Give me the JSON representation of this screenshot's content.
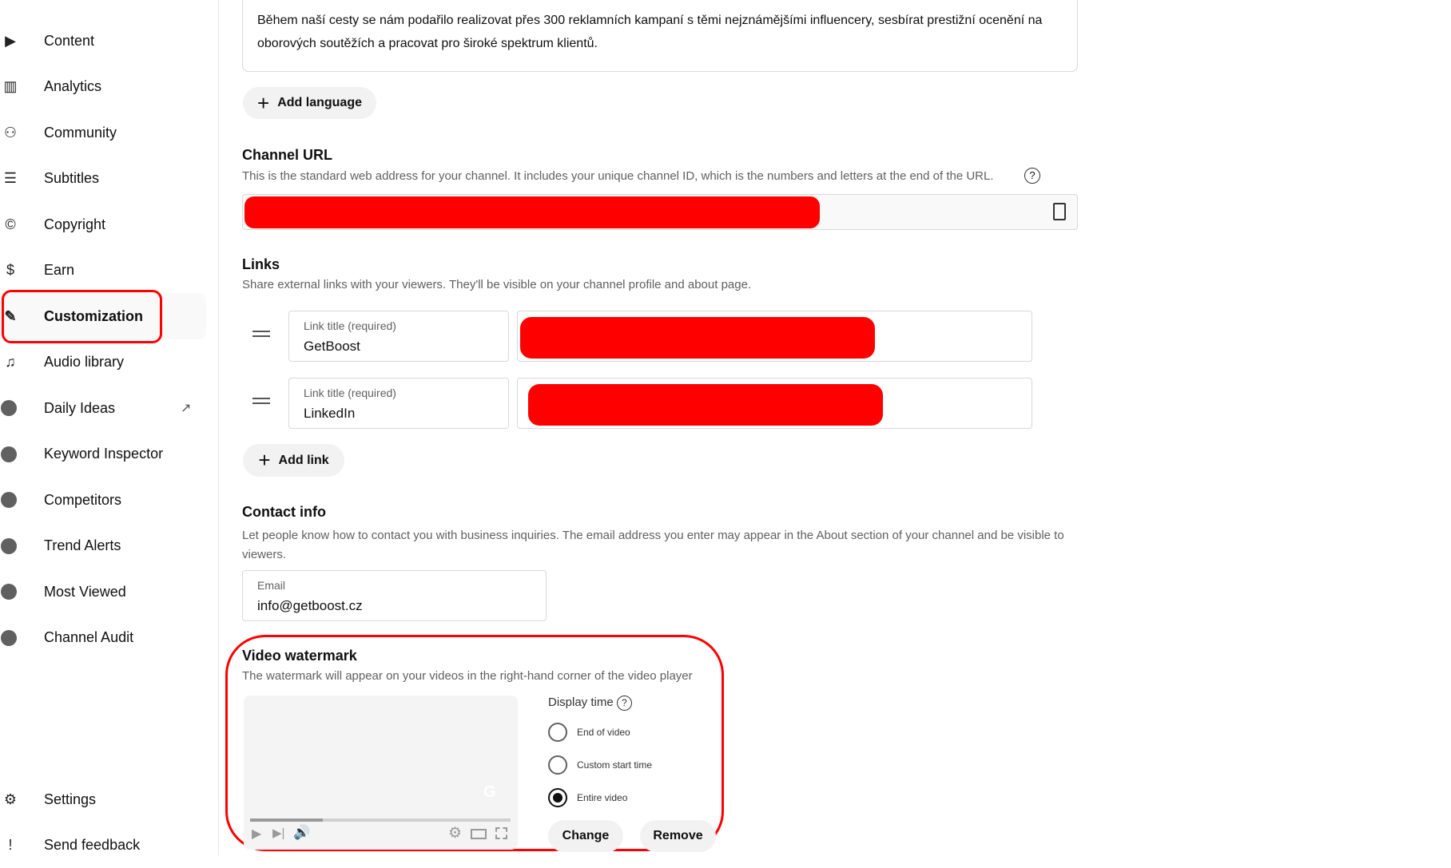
{
  "sidebar": {
    "items": [
      {
        "label": "Content",
        "icon": "content-icon",
        "glyph": "▶"
      },
      {
        "label": "Analytics",
        "icon": "analytics-icon",
        "glyph": "▥"
      },
      {
        "label": "Community",
        "icon": "community-icon",
        "glyph": "⚇"
      },
      {
        "label": "Subtitles",
        "icon": "subtitles-icon",
        "glyph": "☰"
      },
      {
        "label": "Copyright",
        "icon": "copyright-icon",
        "glyph": "©"
      },
      {
        "label": "Earn",
        "icon": "dollar-icon",
        "glyph": "$"
      },
      {
        "label": "Customization",
        "icon": "magic-wand-icon",
        "glyph": "✎"
      },
      {
        "label": "Audio library",
        "icon": "audio-library-icon",
        "glyph": "♫"
      },
      {
        "label": "Daily Ideas",
        "icon": "extension-icon",
        "glyph": ""
      },
      {
        "label": "Keyword Inspector",
        "icon": "extension-icon",
        "glyph": ""
      },
      {
        "label": "Competitors",
        "icon": "extension-icon",
        "glyph": ""
      },
      {
        "label": "Trend Alerts",
        "icon": "extension-icon",
        "glyph": ""
      },
      {
        "label": "Most Viewed",
        "icon": "extension-icon",
        "glyph": ""
      },
      {
        "label": "Channel Audit",
        "icon": "extension-icon",
        "glyph": ""
      }
    ],
    "settings": "Settings",
    "feedback": "Send feedback",
    "external_glyph": "↗"
  },
  "description": {
    "text": "Během naší cesty se nám podařilo realizovat přes 300 reklamních kampaní s těmi nejznámějšími influencery, sesbírat prestižní ocenění na oborových soutěžích a pracovat pro široké spektrum klientů."
  },
  "add_language": "Add language",
  "channel_url": {
    "title": "Channel URL",
    "desc": "This is the standard web address for your channel. It includes your unique channel ID, which is the numbers and letters at the end of the URL.",
    "help": "?"
  },
  "links": {
    "title": "Links",
    "desc": "Share external links with your viewers. They'll be visible on your channel profile and about page.",
    "rows": [
      {
        "label": "Link title (required)",
        "value": "GetBoost"
      },
      {
        "label": "Link title (required)",
        "value": "LinkedIn"
      }
    ],
    "add": "Add link"
  },
  "contact": {
    "title": "Contact info",
    "desc": "Let people know how to contact you with business inquiries. The email address you enter may appear in the About section of your channel and be visible to viewers.",
    "email_label": "Email",
    "email_value": "info@getboost.cz"
  },
  "watermark": {
    "title": "Video watermark",
    "desc": "The watermark will appear on your videos in the right-hand corner of the video player",
    "display_time": "Display time",
    "options": [
      "End of video",
      "Custom start time",
      "Entire video"
    ],
    "selected": "Entire video",
    "change": "Change",
    "remove": "Remove",
    "progress_percent": 28
  },
  "colors": {
    "highlight": "#ff0000",
    "redaction": "#ff0000"
  }
}
